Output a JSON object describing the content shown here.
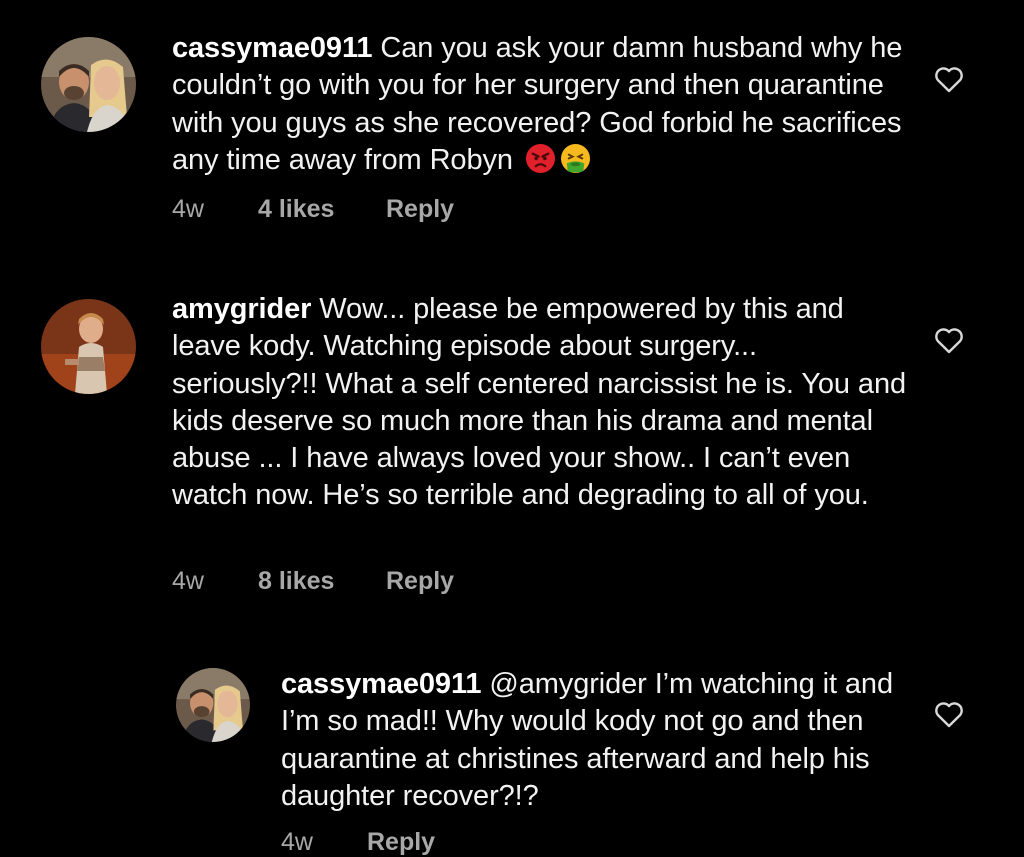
{
  "colors": {
    "background": "#000000",
    "text": "#f2f2f2",
    "meta": "#a8a8a8",
    "angry_face": "#e0202b",
    "nauseated_face": "#f6b91e"
  },
  "comments": [
    {
      "username": "cassymae0911",
      "text": "Can you ask your damn husband why he couldn’t go with you for her surgery and then quarantine with you guys as she recovered? God forbid he sacrifices any time away from Robyn",
      "emojis": [
        "angry-face-emoji",
        "face-vomiting-emoji"
      ],
      "time": "4w",
      "likes": "4 likes",
      "reply": "Reply"
    },
    {
      "username": "amygrider",
      "text": "Wow... please be empowered by this and leave kody. Watching episode about surgery... seriously?!! What a self centered narcissist he is. You and kids deserve so much more than his drama and mental abuse ... I have always loved your show.. I can’t even watch now. He’s so terrible and degrading to all of you.",
      "time": "4w",
      "likes": "8 likes",
      "reply": "Reply"
    },
    {
      "username": "cassymae0911",
      "mention": "@amygrider",
      "text": "I’m watching it and I’m so mad!! Why would kody not go and then quarantine at christines afterward and help his daughter recover?!?",
      "time": "4w",
      "reply": "Reply"
    }
  ]
}
